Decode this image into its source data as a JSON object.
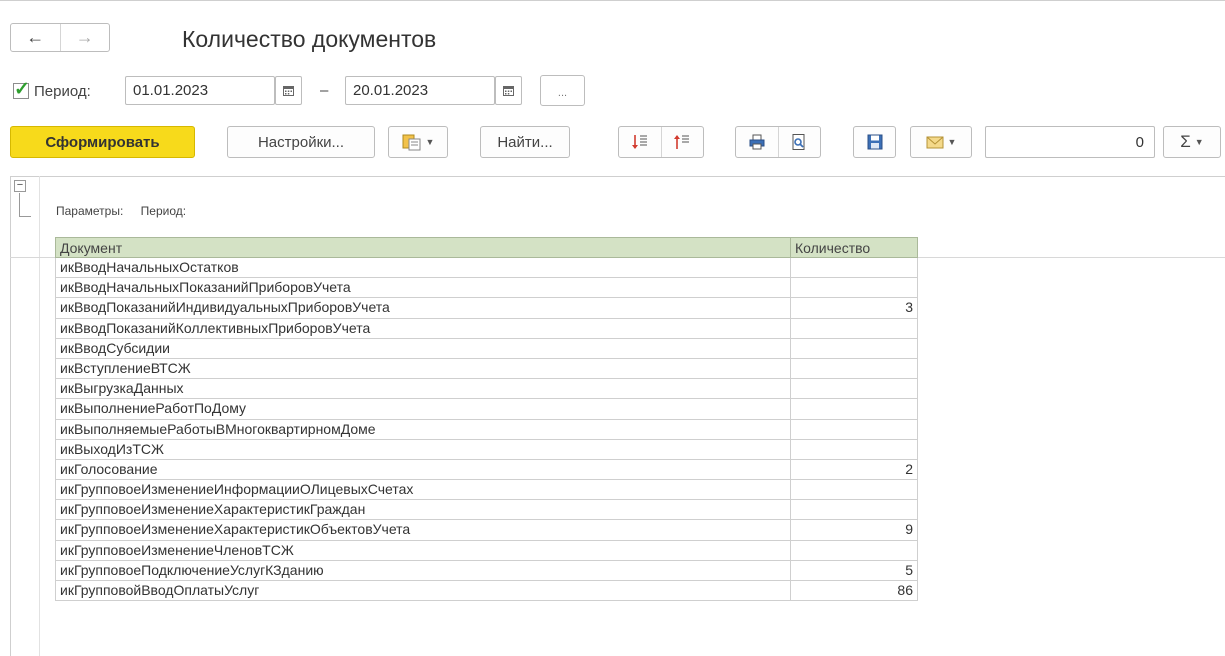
{
  "window": {
    "title": "Количество документов"
  },
  "nav": {
    "back": "←",
    "forward": "→"
  },
  "period": {
    "label": "Период:",
    "start": "01.01.2023",
    "dash": "–",
    "end": "20.01.2023",
    "more": "..."
  },
  "toolbar": {
    "generate": "Сформировать",
    "settings": "Настройки...",
    "find": "Найти...",
    "number_value": "0",
    "sum_symbol": "Σ"
  },
  "report": {
    "params_label": "Параметры:",
    "period_label": "Период:",
    "columns": [
      "Документ",
      "Количество"
    ],
    "rows": [
      {
        "doc": "икВводНачальныхОстатков",
        "count": ""
      },
      {
        "doc": "икВводНачальныхПоказанийПриборовУчета",
        "count": ""
      },
      {
        "doc": "икВводПоказанийИндивидуальныхПриборовУчета",
        "count": "3"
      },
      {
        "doc": "икВводПоказанийКоллективныхПриборовУчета",
        "count": ""
      },
      {
        "doc": "икВводСубсидии",
        "count": ""
      },
      {
        "doc": "икВступлениеВТСЖ",
        "count": ""
      },
      {
        "doc": "икВыгрузкаДанных",
        "count": ""
      },
      {
        "doc": "икВыполнениеРаботПоДому",
        "count": ""
      },
      {
        "doc": "икВыполняемыеРаботыВМногоквартирномДоме",
        "count": ""
      },
      {
        "doc": "икВыходИзТСЖ",
        "count": ""
      },
      {
        "doc": "икГолосование",
        "count": "2"
      },
      {
        "doc": "икГрупповоеИзменениеИнформацииОЛицевыхСчетах",
        "count": ""
      },
      {
        "doc": "икГрупповоеИзменениеХарактеристикГраждан",
        "count": ""
      },
      {
        "doc": "икГрупповоеИзменениеХарактеристикОбъектовУчета",
        "count": "9"
      },
      {
        "doc": "икГрупповоеИзменениеЧленовТСЖ",
        "count": ""
      },
      {
        "doc": "икГрупповоеПодключениеУслугКЗданию",
        "count": "5"
      },
      {
        "doc": "икГрупповойВводОплатыУслуг",
        "count": "86"
      }
    ]
  },
  "colors": {
    "primary": "#f7da1b",
    "header_bg": "#d4e2c5",
    "check": "#2e9e2e"
  }
}
